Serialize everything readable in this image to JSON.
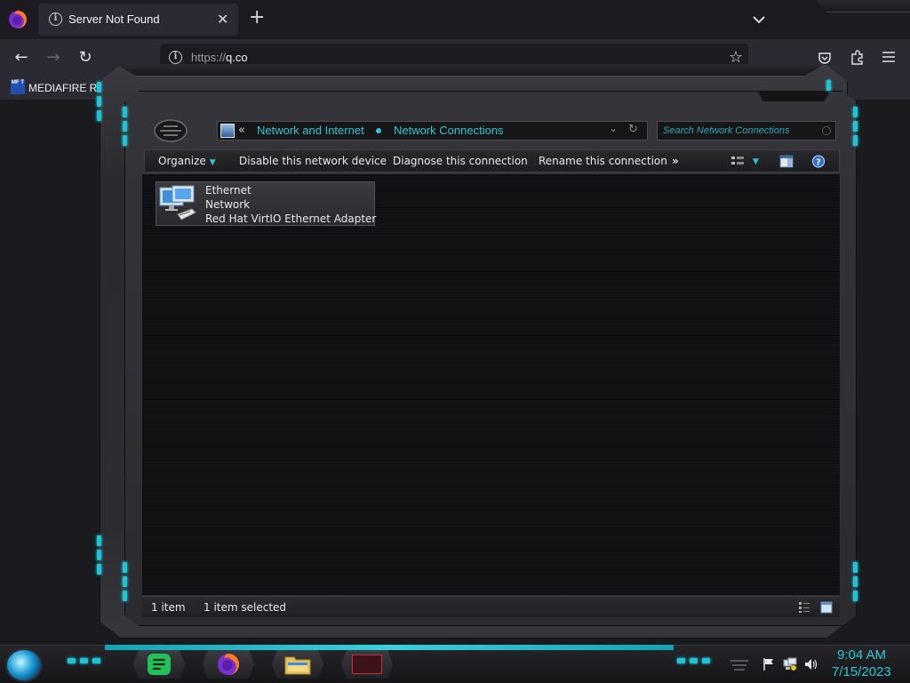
{
  "browser": {
    "tab_title": "Server Not Found",
    "url_prefix": "https://",
    "url_host": "q.co",
    "bookmark_label": "MEDIAFIRE RO",
    "bookmark_icon_text": "MF T"
  },
  "explorer": {
    "breadcrumb_sep": "«",
    "breadcrumb": [
      "Network and Internet",
      "Network Connections"
    ],
    "search_placeholder": "Search Network Connections",
    "toolbar": {
      "organize": "Organize",
      "disable": "Disable this network device",
      "diagnose": "Diagnose this connection",
      "rename": "Rename this connection",
      "more": "»"
    },
    "items": [
      {
        "name": "Ethernet",
        "status": "Network",
        "device": "Red Hat VirtIO Ethernet Adapter"
      }
    ],
    "status": {
      "count": "1 item",
      "selected": "1 item selected"
    }
  },
  "taskbar": {
    "time": "9:04 AM",
    "date": "7/15/2023"
  },
  "colors": {
    "accent_cyan": "#2fc6d2",
    "window_bg": "#101012"
  }
}
